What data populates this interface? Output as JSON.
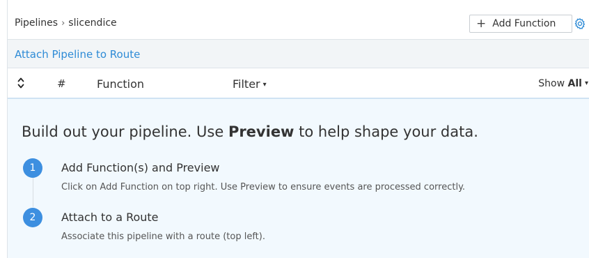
{
  "breadcrumb": {
    "root": "Pipelines",
    "separator": "›",
    "current": "slicendice"
  },
  "toolbar": {
    "add_function_icon": "+",
    "add_function_label": "Add Function",
    "settings_icon": "gear-icon"
  },
  "attach": {
    "label": "Attach Pipeline to Route"
  },
  "columns": {
    "sort_icon": "sort-icon",
    "number": "#",
    "function": "Function",
    "filter": "Filter",
    "filter_caret": "▾",
    "show_prefix": "Show",
    "show_value": "All",
    "show_caret": "▾"
  },
  "empty_state": {
    "headline_pre": "Build out your pipeline. Use ",
    "headline_bold": "Preview",
    "headline_post": " to help shape your data.",
    "steps": [
      {
        "number": "1",
        "title": "Add Function(s) and Preview",
        "description": "Click on Add Function on top right. Use Preview to ensure events are processed correctly."
      },
      {
        "number": "2",
        "title": "Attach to a Route",
        "description": "Associate this pipeline with a route (top left)."
      }
    ]
  },
  "colors": {
    "accent": "#2e8bd6",
    "step_circle": "#3d8fe0",
    "content_bg": "#f2f9fe",
    "header_bg": "#f2f5f7"
  }
}
